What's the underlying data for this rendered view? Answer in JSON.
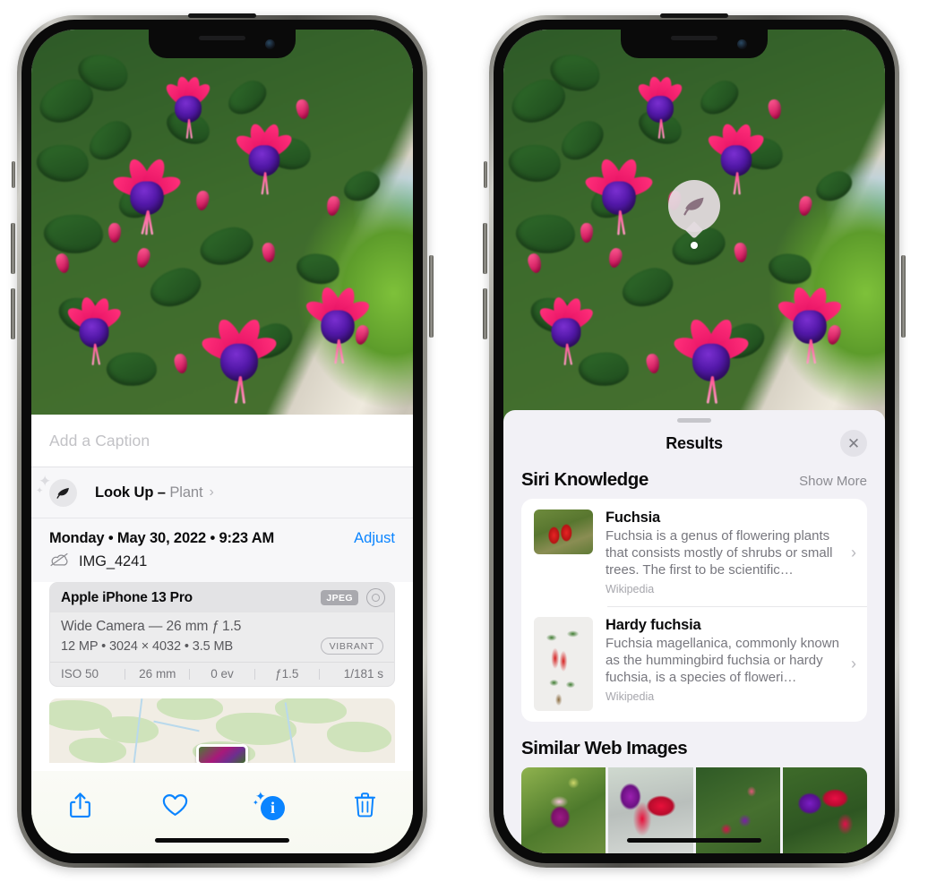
{
  "left_phone": {
    "photo": {
      "alt_name": "fuchsia-flowers-photo"
    },
    "caption_field": {
      "placeholder": "Add a Caption",
      "value": ""
    },
    "lookup_row": {
      "icon": "leaf-icon",
      "label": "Look Up – ",
      "subject": "Plant",
      "chevron": "›"
    },
    "metadata": {
      "date_line": "Monday • May 30, 2022 • 9:23 AM",
      "adjust_label": "Adjust",
      "cloud_icon": "cloud-slash-icon",
      "filename": "IMG_4241"
    },
    "camera_card": {
      "model": "Apple iPhone 13 Pro",
      "format_badge": "JPEG",
      "raw_icon": "raw-toggle-icon",
      "lens_line": "Wide Camera — 26 mm ƒ 1.5",
      "size_line": "12 MP • 3024 × 4032 • 3.5 MB",
      "style_badge": "VIBRANT",
      "exif": [
        "ISO 50",
        "26 mm",
        "0 ev",
        "ƒ1.5",
        "1/181 s"
      ]
    },
    "map": {
      "name": "location-map"
    },
    "toolbar": [
      {
        "name": "share-button",
        "icon": "share-icon"
      },
      {
        "name": "favorite-button",
        "icon": "heart-icon"
      },
      {
        "name": "info-button",
        "icon": "info-sparkle-icon",
        "glyph": "i"
      },
      {
        "name": "delete-button",
        "icon": "trash-icon"
      }
    ]
  },
  "right_phone": {
    "leaf_pin": {
      "icon": "leaf-icon"
    },
    "sheet": {
      "title": "Results",
      "close_label": "✕",
      "sections": [
        {
          "heading": "Siri Knowledge",
          "action": "Show More",
          "items": [
            {
              "title": "Fuchsia",
              "description": "Fuchsia is a genus of flowering plants that consists mostly of shrubs or small trees. The first to be scientific…",
              "source": "Wikipedia",
              "chevron": "›"
            },
            {
              "title": "Hardy fuchsia",
              "description": "Fuchsia magellanica, commonly known as the hummingbird fuchsia or hardy fuchsia, is a species of floweri…",
              "source": "Wikipedia",
              "chevron": "›"
            }
          ]
        },
        {
          "heading": "Similar Web Images",
          "items": [
            {
              "name": "web-image-1"
            },
            {
              "name": "web-image-2"
            },
            {
              "name": "web-image-3"
            },
            {
              "name": "web-image-4"
            }
          ]
        }
      ]
    }
  },
  "colors": {
    "accent_blue": "#0a84ff",
    "sheet_bg": "#f2f1f6",
    "card_bg": "#ffffff",
    "secondary_text": "#8e8e93"
  }
}
